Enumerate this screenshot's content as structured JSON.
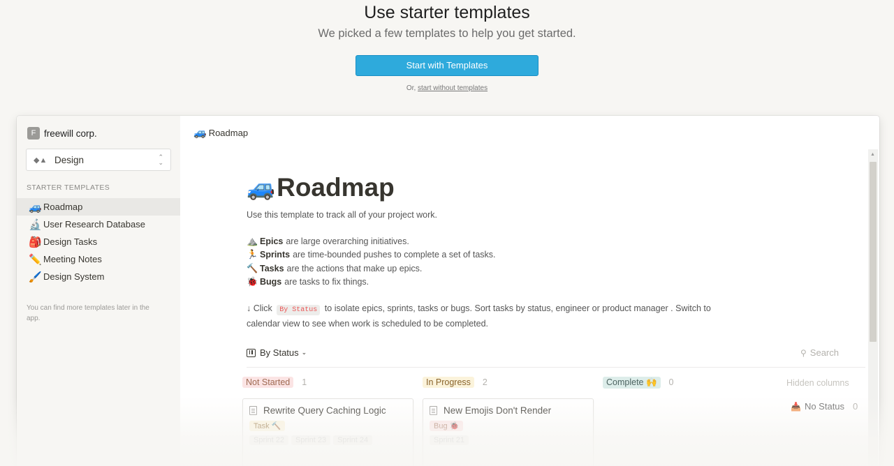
{
  "hero": {
    "title": "Use starter templates",
    "subtitle": "We picked a few templates to help you get started.",
    "cta_label": "Start with Templates",
    "alt_prefix": "Or, ",
    "alt_link": "start without templates"
  },
  "sidebar": {
    "workspace_initial": "F",
    "workspace_name": "freewill corp.",
    "category": "Design",
    "section_title": "STARTER TEMPLATES",
    "items": [
      {
        "emoji": "🚙",
        "label": "Roadmap"
      },
      {
        "emoji": "🔬",
        "label": "User Research Database"
      },
      {
        "emoji": "🎒",
        "label": "Design Tasks"
      },
      {
        "emoji": "✏️",
        "label": "Meeting Notes"
      },
      {
        "emoji": "🖌️",
        "label": "Design System"
      }
    ],
    "note": "You can find more templates later in the app."
  },
  "main": {
    "breadcrumb_emoji": "🚙",
    "breadcrumb": "Roadmap",
    "title_emoji": "🚙",
    "title": "Roadmap",
    "description": "Use this template to track all of your project work.",
    "items": [
      {
        "emoji": "⛰️",
        "bold": "Epics",
        "text": "are large overarching initiatives."
      },
      {
        "emoji": "🏃",
        "bold": "Sprints",
        "text": "are time-bounded pushes to complete a set of tasks."
      },
      {
        "emoji": "🔨",
        "bold": "Tasks",
        "text": "are the actions that make up epics."
      },
      {
        "emoji": "🐞",
        "bold": "Bugs",
        "text": "are tasks to fix things."
      }
    ],
    "howto_prefix": "↓ Click",
    "howto_code": "By Status",
    "howto_rest": "to isolate epics, sprints, tasks or bugs. Sort tasks by status, engineer or product manager . Switch to calendar view to see when work is scheduled to be completed."
  },
  "board": {
    "view_label": "By Status",
    "search_placeholder": "Search",
    "columns": [
      {
        "label": "Not Started",
        "count": "1",
        "bg": "#fbe4e4",
        "fg": "#9f6b53"
      },
      {
        "label": "In Progress",
        "count": "2",
        "bg": "#fbf3db",
        "fg": "#89632a"
      },
      {
        "label": "Complete 🙌",
        "count": "0",
        "bg": "#ddedea",
        "fg": "#4d6461"
      }
    ],
    "hidden_columns": "Hidden columns",
    "no_status": "No Status",
    "no_status_count": "0",
    "cards": [
      {
        "title": "Rewrite Query Caching Logic",
        "tag": "Task 🔨",
        "tag_bg": "#fbf3db",
        "tag_fg": "#89632a",
        "sprints": [
          "Sprint 22",
          "Sprint 23",
          "Sprint 24"
        ]
      },
      {
        "title": "New Emojis Don't Render",
        "tag": "Bug 🐞",
        "tag_bg": "#fbe4e4",
        "tag_fg": "#9f6b53",
        "sprints": [
          "Sprint 21"
        ]
      }
    ]
  }
}
